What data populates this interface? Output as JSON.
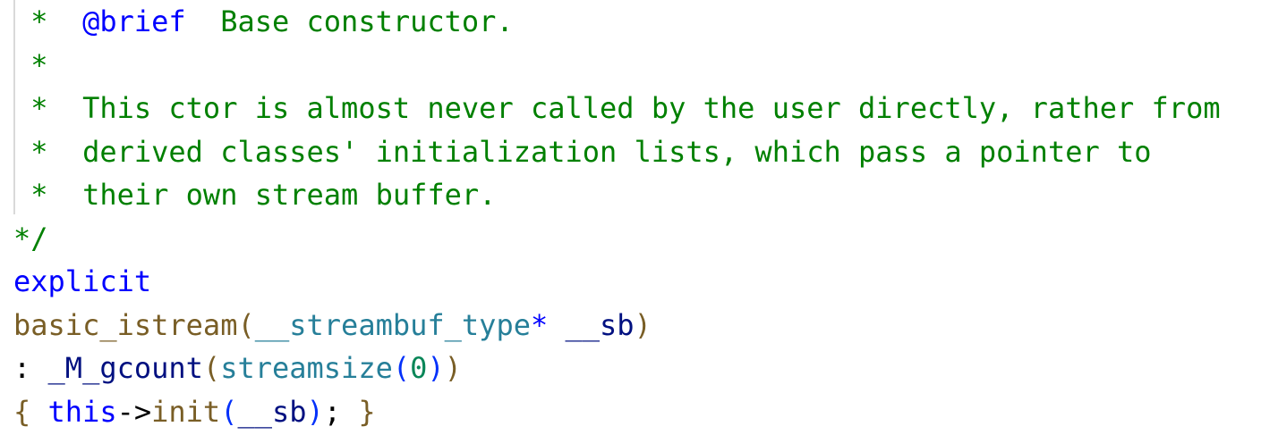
{
  "editor": {
    "lines": {
      "l1": {
        "star": " *",
        "space": "  ",
        "tag": "@brief",
        "gap": "  ",
        "text": "Base constructor."
      },
      "l2": {
        "star": " *"
      },
      "l3": {
        "star": " *",
        "space": "  ",
        "text": "This ctor is almost never called by the user directly, rather from"
      },
      "l4": {
        "star": " *",
        "space": "  ",
        "text": "derived classes' initialization lists, which pass a pointer to"
      },
      "l5": {
        "star": " *",
        "space": "  ",
        "text": "their own stream buffer."
      },
      "l6": {
        "text": "*/"
      },
      "l7": {
        "text": "explicit"
      },
      "l8": {
        "fn": "basic_istream",
        "open": "(",
        "type": "__streambuf_type",
        "ptr": "*",
        "sp": " ",
        "param": "__sb",
        "close": ")"
      },
      "l9": {
        "colon": ":",
        "sp": " ",
        "member": "_M_gcount",
        "open": "(",
        "fn": "streamsize",
        "open2": "(",
        "num": "0",
        "close2": ")",
        "close": ")"
      },
      "l10": {
        "lbrace": "{",
        "sp1": " ",
        "this": "this",
        "arrow": "->",
        "fn": "init",
        "open": "(",
        "param": "__sb",
        "close": ")",
        "semi": ";",
        "sp2": " ",
        "rbrace": "}"
      }
    }
  }
}
